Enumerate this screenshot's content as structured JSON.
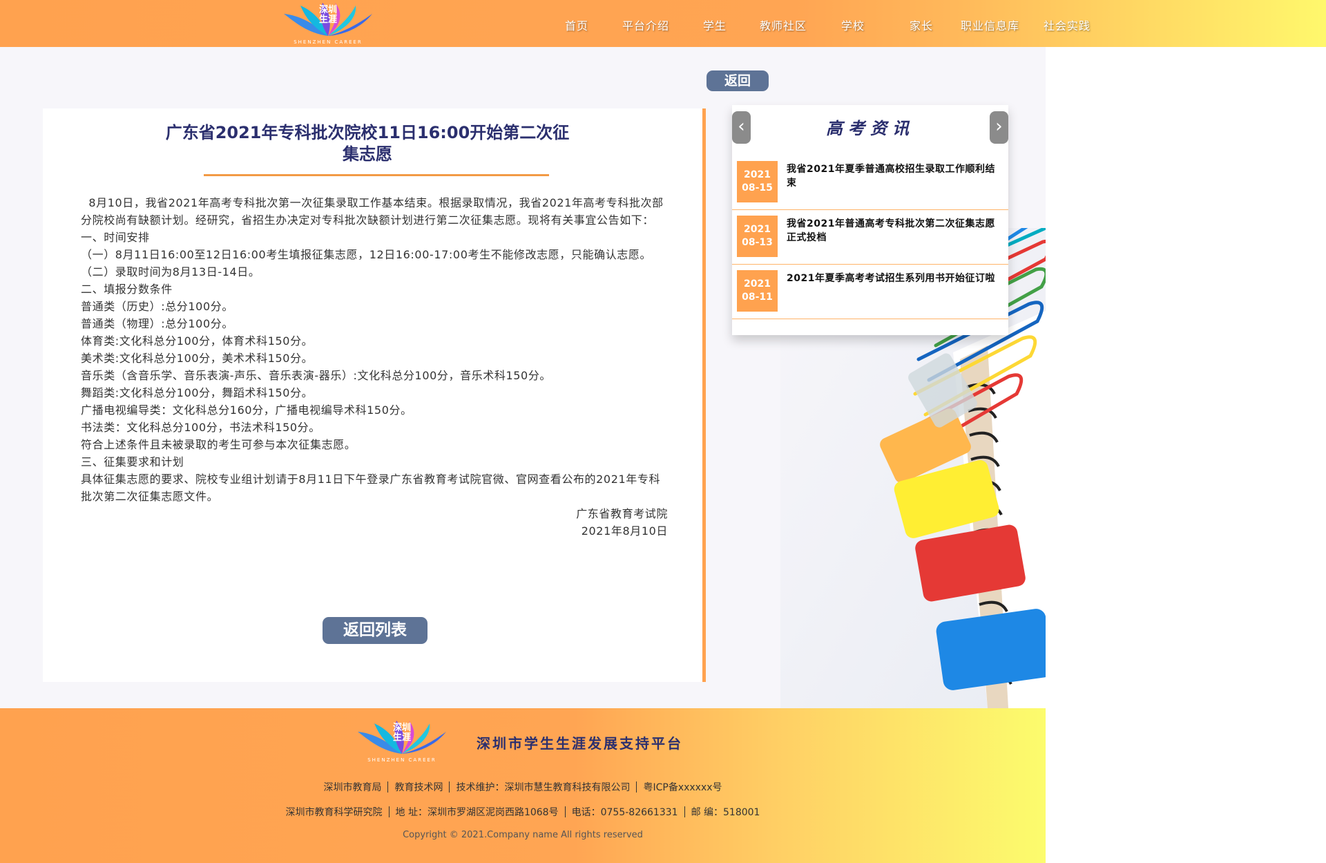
{
  "header": {
    "logo_line1": "深圳",
    "logo_line2": "生涯",
    "logo_en": "SHENZHEN CAREER",
    "nav": [
      "首页",
      "平台介绍",
      "学生",
      "教师社区",
      "学校",
      "家长",
      "职业信息库",
      "社会实践"
    ]
  },
  "buttons": {
    "back": "返回",
    "back_list": "返回列表"
  },
  "article": {
    "title_line1": "广东省2021年专科批次院校11日16:00开始第二次征",
    "title_line2": "集志愿",
    "paragraphs": [
      "  8月10日，我省2021年高考专科批次第一次征集录取工作基本结束。根据录取情况，我省2021年高考专科批次部分院校尚有缺额计划。经研究，省招生办决定对专科批次缺额计划进行第二次征集志愿。现将有关事宜公告如下：",
      "一、时间安排",
      "（一）8月11日16:00至12日16:00考生填报征集志愿，12日16:00-17:00考生不能修改志愿，只能确认志愿。",
      "（二）录取时间为8月13日-14日。",
      "二、填报分数条件",
      "普通类（历史）:总分100分。",
      "普通类（物理）:总分100分。",
      "体育类:文化科总分100分，体育术科150分。",
      "美术类:文化科总分100分，美术术科150分。",
      "音乐类（含音乐学、音乐表演-声乐、音乐表演-器乐）:文化科总分100分，音乐术科150分。",
      "舞蹈类:文化科总分100分，舞蹈术科150分。",
      "广播电视编导类：文化科总分160分，广播电视编导术科150分。",
      "书法类：文化科总分100分，书法术科150分。",
      "符合上述条件且未被录取的考生可参与本次征集志愿。",
      "三、征集要求和计划",
      "具体征集志愿的要求、院校专业组计划请于8月11日下午登录广东省教育考试院官微、官网查看公布的2021年专科批次第二次征集志愿文件。"
    ],
    "signature": "广东省教育考试院",
    "date": "2021年8月10日"
  },
  "news": {
    "title": "高考资讯",
    "prev_icon": "‹",
    "next_icon": "›",
    "items": [
      {
        "year": "2021",
        "md": "08-15",
        "text": "我省2021年夏季普通高校招生录取工作顺利结束"
      },
      {
        "year": "2021",
        "md": "08-13",
        "text": "我省2021年普通高考专科批次第二次征集志愿正式投档"
      },
      {
        "year": "2021",
        "md": "08-11",
        "text": "2021年夏季高考考试招生系列用书开始征订啦"
      }
    ]
  },
  "footer": {
    "platform_name": "深圳市学生生涯发展支持平台",
    "line1": [
      "深圳市教育局",
      "教育技术网",
      "技术维护：深圳市慧生教育科技有限公司",
      "粤ICP备xxxxxx号"
    ],
    "line2": [
      "深圳市教育科学研究院",
      "地  址：深圳市罗湖区泥岗西路1068号",
      "电话：0755-82661331",
      "邮  编：518001"
    ],
    "copyright": "Copyright © 2021.Company name All rights reserved"
  },
  "colors": {
    "accent_orange": "#ffa24f",
    "navy_title": "#2b2f6e",
    "button_blue": "#5e7396"
  }
}
